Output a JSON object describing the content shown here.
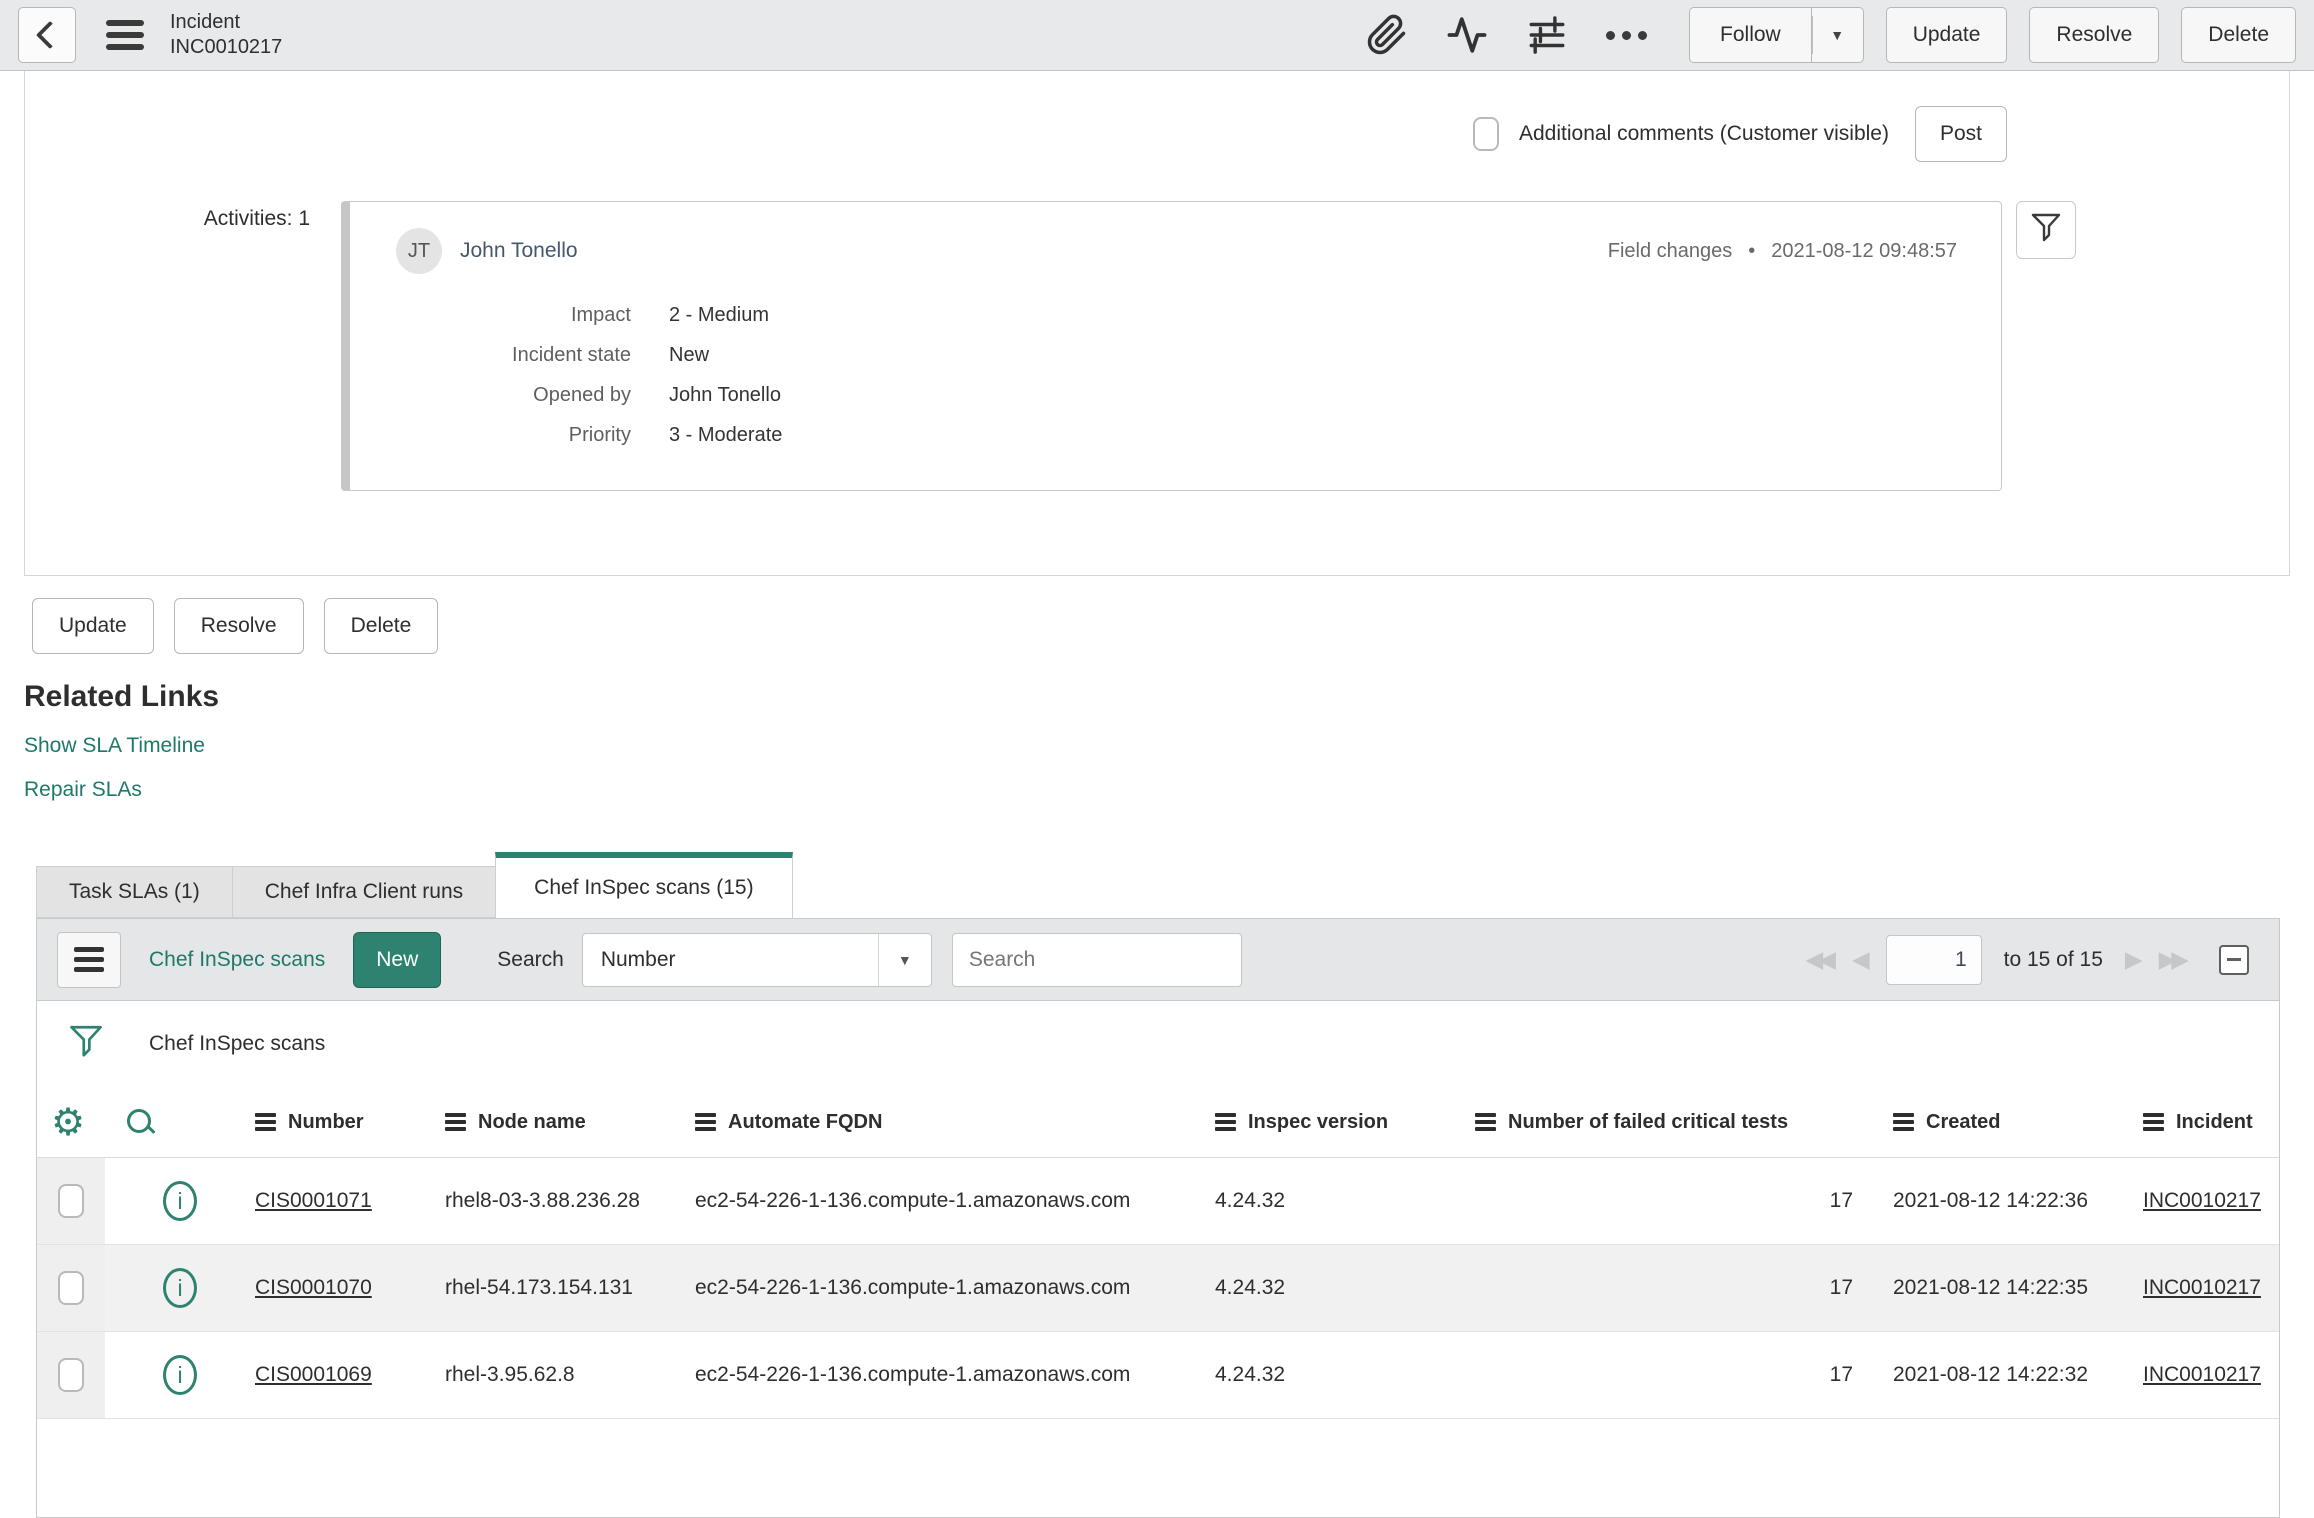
{
  "header": {
    "title_line1": "Incident",
    "title_line2": "INC0010217",
    "follow_label": "Follow",
    "update_label": "Update",
    "resolve_label": "Resolve",
    "delete_label": "Delete"
  },
  "comments": {
    "label": "Additional comments (Customer visible)",
    "post_label": "Post",
    "checked": false
  },
  "activities": {
    "label": "Activities: 1",
    "entry": {
      "avatar_initials": "JT",
      "user": "John Tonello",
      "type": "Field changes",
      "separator": "•",
      "timestamp": "2021-08-12 09:48:57",
      "fields": [
        {
          "label": "Impact",
          "value": "2 - Medium"
        },
        {
          "label": "Incident state",
          "value": "New"
        },
        {
          "label": "Opened by",
          "value": "John Tonello"
        },
        {
          "label": "Priority",
          "value": "3 - Moderate"
        }
      ]
    }
  },
  "form_actions": [
    "Update",
    "Resolve",
    "Delete"
  ],
  "related_links": {
    "title": "Related Links",
    "links": [
      "Show SLA Timeline",
      "Repair SLAs"
    ]
  },
  "tabs": [
    {
      "label": "Task SLAs (1)",
      "active": false
    },
    {
      "label": "Chef Infra Client runs",
      "active": false
    },
    {
      "label": "Chef InSpec scans (15)",
      "active": true
    }
  ],
  "list": {
    "title": "Chef InSpec scans",
    "new_button": "New",
    "search_label": "Search",
    "search_field_value": "Number",
    "search_placeholder": "Search",
    "pagination": {
      "current_page": "1",
      "range_text": "to 15 of 15"
    },
    "breadcrumb": "Chef InSpec scans",
    "columns": [
      "Number",
      "Node name",
      "Automate FQDN",
      "Inspec version",
      "Number of failed critical tests",
      "Created",
      "Incident"
    ],
    "rows": [
      {
        "number": "CIS0001071",
        "node_name": "rhel8-03-3.88.236.28",
        "automate_fqdn": "ec2-54-226-1-136.compute-1.amazonaws.com",
        "inspec_version": "4.24.32",
        "failed_critical_tests": "17",
        "created": "2021-08-12 14:22:36",
        "incident": "INC0010217",
        "checked": false
      },
      {
        "number": "CIS0001070",
        "node_name": "rhel-54.173.154.131",
        "automate_fqdn": "ec2-54-226-1-136.compute-1.amazonaws.com",
        "inspec_version": "4.24.32",
        "failed_critical_tests": "17",
        "created": "2021-08-12 14:22:35",
        "incident": "INC0010217",
        "checked": false
      },
      {
        "number": "CIS0001069",
        "node_name": "rhel-3.95.62.8",
        "automate_fqdn": "ec2-54-226-1-136.compute-1.amazonaws.com",
        "inspec_version": "4.24.32",
        "failed_critical_tests": "17",
        "created": "2021-08-12 14:22:32",
        "incident": "INC0010217",
        "checked": false
      }
    ]
  },
  "colors": {
    "accent_teal": "#2e8270",
    "link_teal": "#1d7a68",
    "header_bg": "#e8e9ea"
  }
}
